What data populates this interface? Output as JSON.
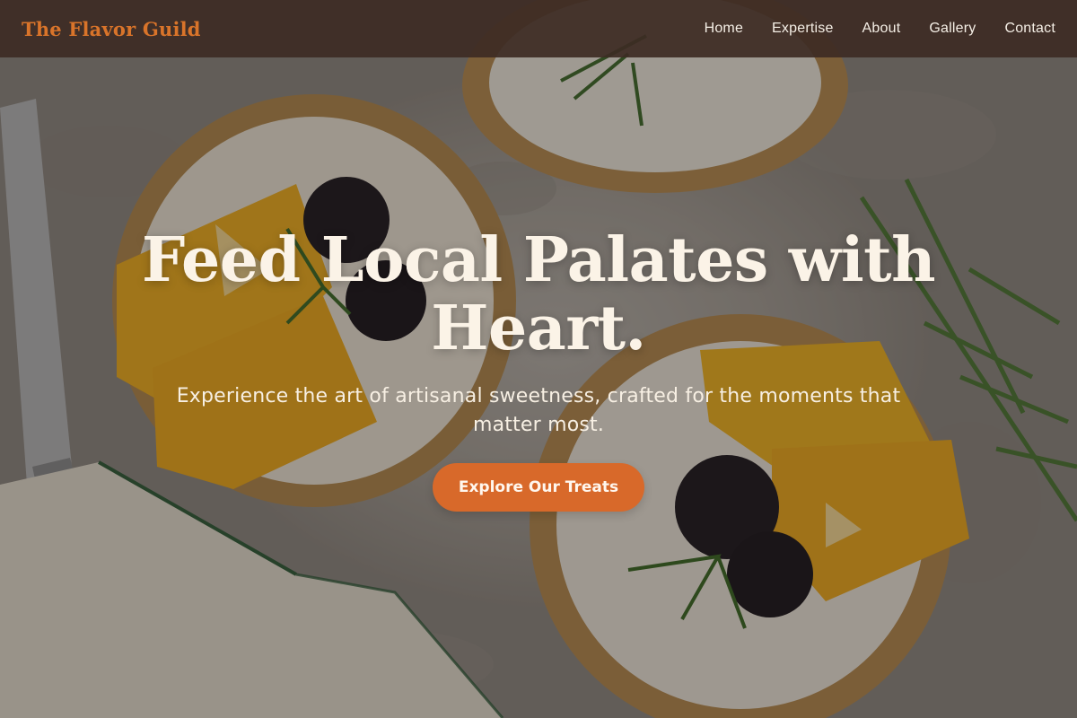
{
  "header": {
    "brand": "The Flavor Guild",
    "nav": [
      {
        "label": "Home"
      },
      {
        "label": "Expertise"
      },
      {
        "label": "About"
      },
      {
        "label": "Gallery"
      },
      {
        "label": "Contact"
      }
    ]
  },
  "hero": {
    "title": "Feed Local Palates with Heart.",
    "subtitle": "Experience the art of artisanal sweetness, crafted for the moments that matter most.",
    "cta_label": "Explore Our Treats"
  },
  "colors": {
    "brand_accent": "#d9742a",
    "header_bg": "#3d2b24",
    "cta_bg": "#d8692a",
    "hero_text": "#fbf3e7"
  },
  "icons": {
    "background_image": "tarts-with-orange-blackberry-rosemary-photo"
  }
}
